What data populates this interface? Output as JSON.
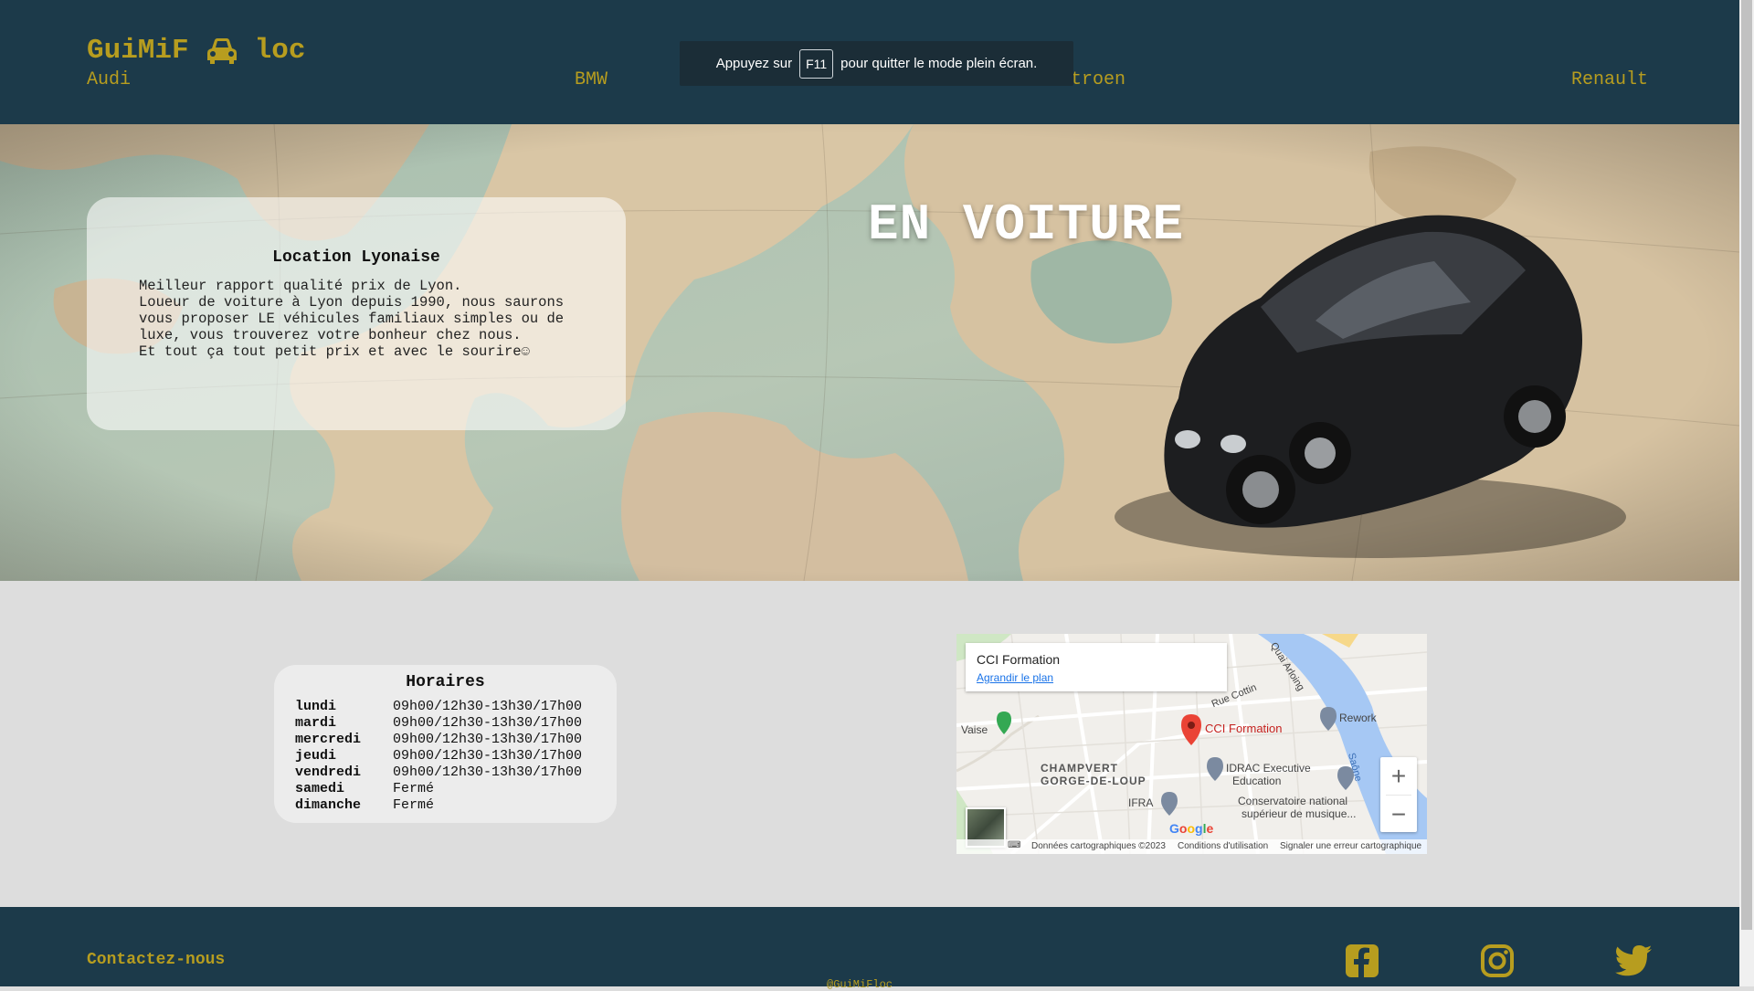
{
  "header": {
    "logo_left": "GuiMiF",
    "logo_icon": "car-icon",
    "logo_right": "loc",
    "nav": [
      "Audi",
      "BMW",
      "Citroen",
      "Renault"
    ]
  },
  "toast": {
    "before": "Appuyez sur",
    "key": "F11",
    "after": "pour quitter le mode plein écran."
  },
  "hero": {
    "title": "EN VOITURE",
    "card_title": "Location Lyonaise",
    "card_lines": [
      "Meilleur rapport qualité prix de Lyon.",
      "Loueur de voiture à Lyon depuis 1990, nous saurons vous proposer LE véhicules familiaux simples ou de luxe, vous trouverez votre bonheur chez nous.",
      "Et tout ça tout petit prix et avec le sourire☺"
    ]
  },
  "hours": {
    "title": "Horaires",
    "rows": [
      {
        "day": "lundi",
        "time": "09h00/12h30-13h30/17h00"
      },
      {
        "day": "mardi",
        "time": "09h00/12h30-13h30/17h00"
      },
      {
        "day": "mercredi",
        "time": "09h00/12h30-13h30/17h00"
      },
      {
        "day": "jeudi",
        "time": "09h00/12h30-13h30/17h00"
      },
      {
        "day": "vendredi",
        "time": "09h00/12h30-13h30/17h00"
      },
      {
        "day": "samedi",
        "time": "Fermé"
      },
      {
        "day": "dimanche",
        "time": "Fermé"
      }
    ]
  },
  "map": {
    "place_name": "CCI Formation",
    "enlarge_link": "Agrandir le plan",
    "labels": {
      "vaise": "Vaise",
      "cci": "CCI Formation",
      "rework": "Rework",
      "champvert": "CHAMPVERT",
      "gorge": "GORGE-DE-LOUP",
      "idrac": "IDRAC Executive",
      "education": "Education",
      "ifra": "IFRA",
      "conservatoire1": "Conservatoire national",
      "conservatoire2": "supérieur de musique...",
      "rue_cottin": "Rue Cottin",
      "quai": "Quai Arloing",
      "saone": "Saône"
    },
    "zoom_in": "+",
    "zoom_out": "−",
    "google": "Google",
    "footer": {
      "data": "Données cartographiques ©2023",
      "terms": "Conditions d'utilisation",
      "report": "Signaler une erreur cartographique"
    }
  },
  "footer": {
    "contact": "Contactez-nous",
    "copyright": "@GuiMiFloc",
    "social": [
      "facebook-icon",
      "instagram-icon",
      "twitter-icon"
    ]
  },
  "colors": {
    "header_bg": "#1c3a4a",
    "accent": "#b79d1f",
    "page_bg": "#dddddd"
  }
}
